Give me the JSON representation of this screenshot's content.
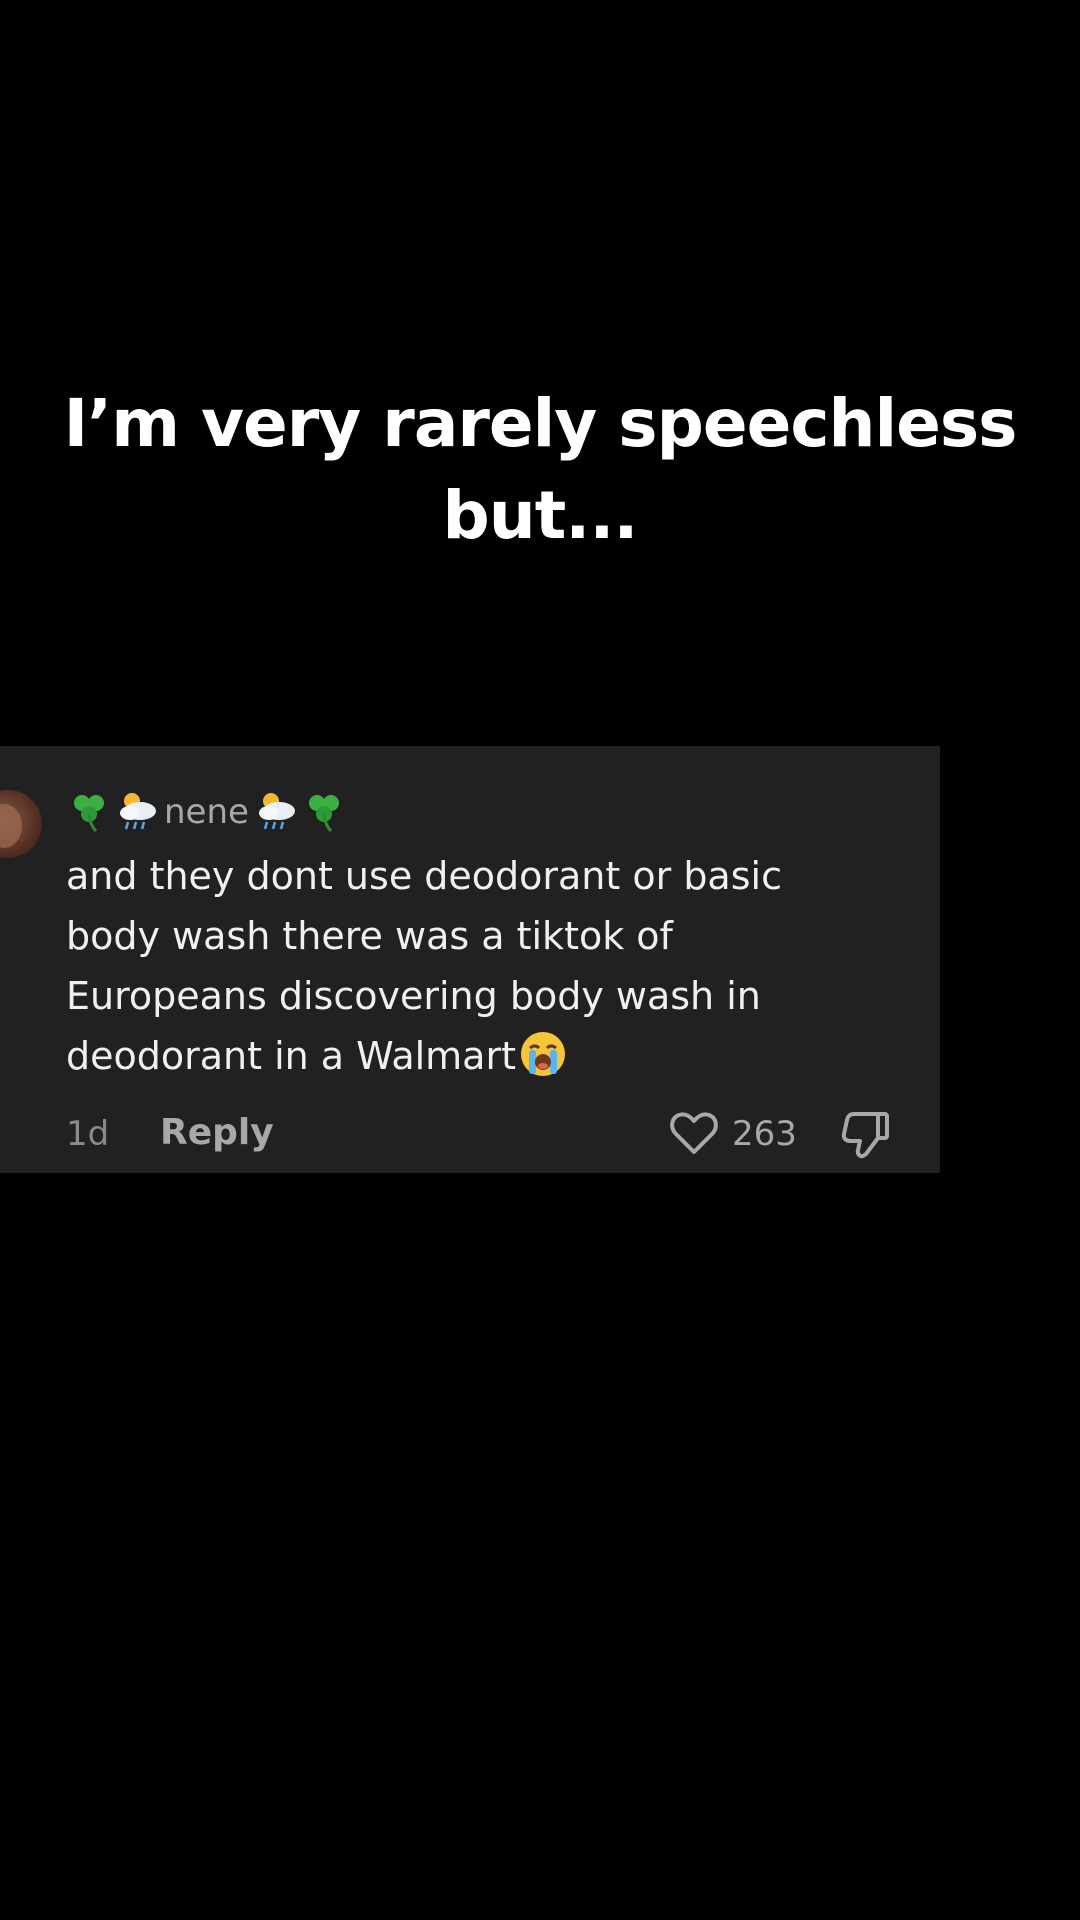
{
  "caption": {
    "line1": "I’m very rarely speechless",
    "line2": "but..."
  },
  "comment": {
    "username": "nene",
    "username_emojis": [
      "shamrock-icon",
      "sun-behind-rain-cloud-icon",
      "sun-behind-rain-cloud-icon",
      "shamrock-icon"
    ],
    "body_lines": [
      "and they dont use deodorant or basic",
      "body wash there was a tiktok of",
      "Europeans discovering body wash in",
      "deodorant in a Walmart"
    ],
    "trailing_emoji": "loudly-crying-face-icon",
    "timestamp": "1d",
    "reply_label": "Reply",
    "like_count": "263"
  },
  "colors": {
    "background": "#000000",
    "card": "#212121",
    "primary_text": "#f0f0f0",
    "secondary_text": "#a8a8a8",
    "clover": "#39b54a"
  }
}
